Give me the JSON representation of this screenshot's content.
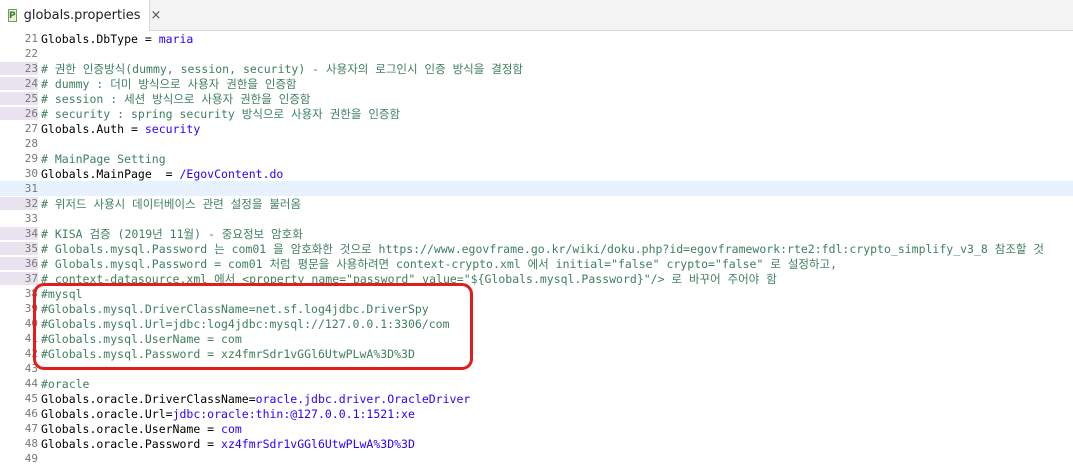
{
  "tab": {
    "title": "globals.properties",
    "icon": "properties-file-icon",
    "icon_letter": "P",
    "close": "×"
  },
  "colors": {
    "comment": "#3f7f5f",
    "value": "#2a00ff",
    "key": "#000000",
    "highlight": "#e51c1c",
    "current_line": "#e8f2fe"
  },
  "lines": [
    {
      "n": "21",
      "text": "Globals.DbType = maria",
      "kind": "kv",
      "key": "Globals.DbType",
      "value": "maria"
    },
    {
      "n": "22",
      "text": "",
      "kind": "blank"
    },
    {
      "n": "23",
      "text": "# 권한 인증방식(dummy, session, security) - 사용자의 로그인시 인증 방식을 결정함",
      "kind": "comment",
      "marker": true
    },
    {
      "n": "24",
      "text": "# dummy : 더미 방식으로 사용자 권한을 인증함",
      "kind": "comment",
      "marker": true
    },
    {
      "n": "25",
      "text": "# session : 세션 방식으로 사용자 권한을 인증함",
      "kind": "comment",
      "marker": true
    },
    {
      "n": "26",
      "text": "# security : spring security 방식으로 사용자 권한을 인증함",
      "kind": "comment",
      "marker": true
    },
    {
      "n": "27",
      "text": "Globals.Auth = security",
      "kind": "kv",
      "key": "Globals.Auth",
      "value": "security"
    },
    {
      "n": "28",
      "text": "",
      "kind": "blank"
    },
    {
      "n": "29",
      "text": "# MainPage Setting",
      "kind": "comment"
    },
    {
      "n": "30",
      "text": "Globals.MainPage  = /EgovContent.do",
      "kind": "kv",
      "key": "Globals.MainPage",
      "value": "/EgovContent.do"
    },
    {
      "n": "31",
      "text": "",
      "kind": "blank",
      "current": true
    },
    {
      "n": "32",
      "text": "# 위저드 사용시 데이터베이스 관련 설정을 불러옴",
      "kind": "comment",
      "marker": true
    },
    {
      "n": "33",
      "text": "",
      "kind": "blank"
    },
    {
      "n": "34",
      "text": "# KISA 검증 (2019년 11월) - 중요정보 암호화",
      "kind": "comment",
      "marker": true
    },
    {
      "n": "35",
      "text": "# Globals.mysql.Password 는 com01 을 암호화한 것으로 https://www.egovframe.go.kr/wiki/doku.php?id=egovframework:rte2:fdl:crypto_simplify_v3_8 참조할 것",
      "kind": "comment",
      "marker": true
    },
    {
      "n": "36",
      "text": "# Globals.mysql.Password = com01 처럼 평문을 사용하려면 context-crypto.xml 에서 initial=\"false\" crypto=\"false\" 로 설정하고,",
      "kind": "comment",
      "marker": true
    },
    {
      "n": "37",
      "text": "# context-datasource.xml 에서 <property name=\"password\" value=\"${Globals.mysql.Password}\"/> 로 바꾸어 주어야 함",
      "kind": "comment",
      "marker": true
    },
    {
      "n": "38",
      "text": "#mysql",
      "kind": "comment"
    },
    {
      "n": "39",
      "text": "#Globals.mysql.DriverClassName=net.sf.log4jdbc.DriverSpy",
      "kind": "comment"
    },
    {
      "n": "40",
      "text": "#Globals.mysql.Url=jdbc:log4jdbc:mysql://127.0.0.1:3306/com",
      "kind": "comment"
    },
    {
      "n": "41",
      "text": "#Globals.mysql.UserName = com",
      "kind": "comment"
    },
    {
      "n": "42",
      "text": "#Globals.mysql.Password = xz4fmrSdr1vGGl6UtwPLwA%3D%3D",
      "kind": "comment"
    },
    {
      "n": "43",
      "text": "",
      "kind": "blank"
    },
    {
      "n": "44",
      "text": "#oracle",
      "kind": "comment"
    },
    {
      "n": "45",
      "text": "Globals.oracle.DriverClassName=oracle.jdbc.driver.OracleDriver",
      "kind": "kv",
      "key": "Globals.oracle.DriverClassName",
      "sep": "=",
      "value": "oracle.jdbc.driver.OracleDriver"
    },
    {
      "n": "46",
      "text": "Globals.oracle.Url=jdbc:oracle:thin:@127.0.0.1:1521:xe",
      "kind": "kv",
      "key": "Globals.oracle.Url",
      "sep": "=",
      "value": "jdbc:oracle:thin:@127.0.0.1:1521:xe"
    },
    {
      "n": "47",
      "text": "Globals.oracle.UserName = com",
      "kind": "kv",
      "key": "Globals.oracle.UserName",
      "value": "com"
    },
    {
      "n": "48",
      "text": "Globals.oracle.Password = xz4fmrSdr1vGGl6UtwPLwA%3D%3D",
      "kind": "kv",
      "key": "Globals.oracle.Password",
      "value": "xz4fmrSdr1vGGl6UtwPLwA%3D%3D"
    },
    {
      "n": "49",
      "text": "",
      "kind": "blank"
    }
  ]
}
